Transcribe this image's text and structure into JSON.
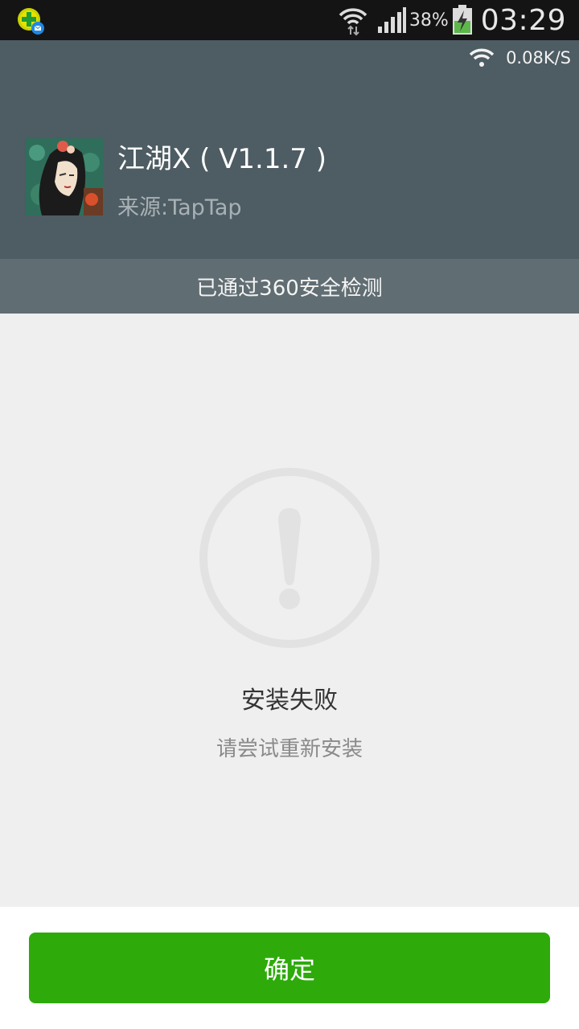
{
  "status_bar": {
    "notification_icon": "green-plus-notification-icon",
    "battery_percent": "38%",
    "time": "03:29"
  },
  "header": {
    "net_speed": "0.08K/S",
    "app_icon": "app-portrait-icon",
    "app_title": "江湖X ( V1.1.7 )",
    "app_source": "来源:TapTap"
  },
  "security": {
    "text": "已通过360安全检测"
  },
  "result": {
    "icon": "exclamation-circle-icon",
    "title": "安装失败",
    "hint": "请尝试重新安装"
  },
  "footer": {
    "confirm_label": "确定"
  },
  "colors": {
    "header_bg": "#4e5c63",
    "security_bg": "#606d73",
    "accent_green": "#2eaa0b",
    "content_bg": "#efefef"
  }
}
